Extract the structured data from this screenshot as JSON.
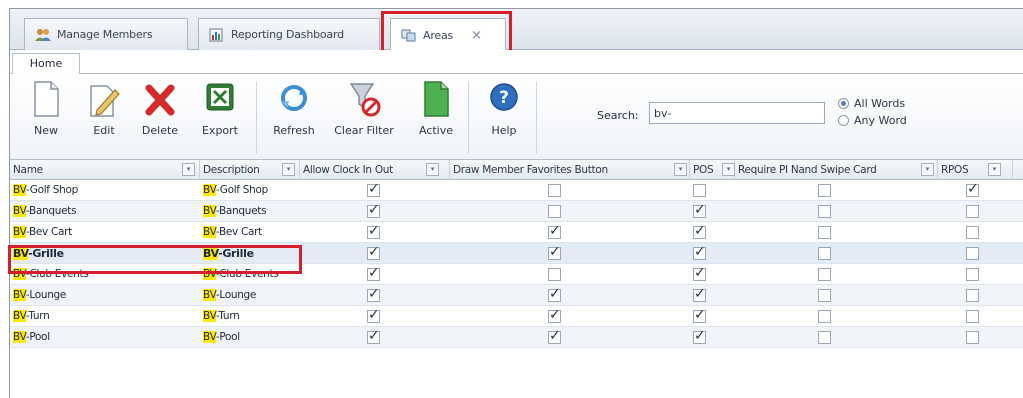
{
  "doc_tabs": [
    {
      "label": "Manage Members",
      "icon": "members-icon"
    },
    {
      "label": "Reporting Dashboard",
      "icon": "dashboard-icon"
    },
    {
      "label": "Areas",
      "icon": "areas-icon",
      "close": "×"
    }
  ],
  "ribbon": {
    "tab": "Home",
    "buttons": {
      "new": "New",
      "edit": "Edit",
      "delete": "Delete",
      "export": "Export",
      "refresh": "Refresh",
      "clear_filter": "Clear Filter",
      "active": "Active",
      "help": "Help"
    },
    "search_label": "Search:",
    "search_value": "bv-",
    "all_words": "All Words",
    "any_word": "Any Word",
    "match_mode": "All Words"
  },
  "grid": {
    "columns": [
      "Name",
      "Description",
      "Allow Clock In Out",
      "Draw Member Favorites Button",
      "POS",
      "Require PI Nand Swipe Card",
      "RPOS"
    ],
    "filter_glyph": "▾",
    "highlight": "BV",
    "rows": [
      {
        "name": "-Golf Shop",
        "description": "-Golf Shop",
        "flags": [
          true,
          false,
          false,
          false,
          true
        ]
      },
      {
        "name": "-Banquets",
        "description": "-Banquets",
        "flags": [
          true,
          false,
          true,
          false,
          false
        ]
      },
      {
        "name": "-Bev Cart",
        "description": "-Bev Cart",
        "flags": [
          true,
          true,
          true,
          false,
          false
        ]
      },
      {
        "name": "-Grille",
        "description": "-Grille",
        "flags": [
          true,
          true,
          true,
          false,
          false
        ]
      },
      {
        "name": "-Club Events",
        "description": "-Club Events",
        "flags": [
          true,
          false,
          true,
          false,
          false
        ]
      },
      {
        "name": "-Lounge",
        "description": "-Lounge",
        "flags": [
          true,
          true,
          true,
          false,
          false
        ]
      },
      {
        "name": "-Turn",
        "description": "-Turn",
        "flags": [
          true,
          true,
          true,
          false,
          false
        ]
      },
      {
        "name": "-Pool",
        "description": "-Pool",
        "flags": [
          true,
          true,
          true,
          false,
          false
        ]
      }
    ],
    "selected_row": 3
  },
  "colors": {
    "annotation_red": "#d4202c",
    "highlight_yellow": "#ffe800",
    "selected_row": "#e3ebf6"
  }
}
